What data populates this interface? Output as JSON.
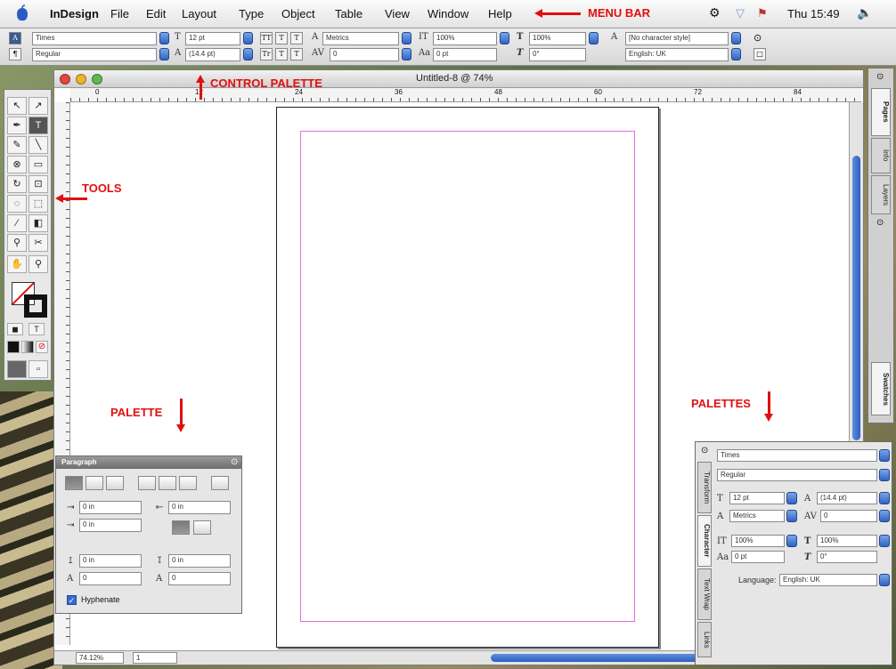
{
  "menubar": {
    "app": "InDesign",
    "items": [
      "File",
      "Edit",
      "Layout",
      "Type",
      "Object",
      "Table",
      "View",
      "Window",
      "Help"
    ],
    "clock": "Thu 15:49"
  },
  "annotations": {
    "menu_bar": "MENU BAR",
    "control_palette": "CONTROL PALETTE",
    "tools": "TOOLS",
    "palette": "PALETTE",
    "palettes": "PALETTES"
  },
  "control": {
    "font": "Times",
    "style": "Regular",
    "size": "12 pt",
    "leading": "(14.4 pt)",
    "kerning": "Metrics",
    "tracking": "0",
    "vscale": "100%",
    "hscale": "100%",
    "baseline": "0 pt",
    "skew": "0°",
    "char_style": "[No character style]",
    "language": "English: UK"
  },
  "document": {
    "title": "Untitled-8 @ 74%",
    "ruler_marks": [
      "0",
      "12",
      "24",
      "36",
      "48",
      "60",
      "72",
      "84"
    ]
  },
  "status": {
    "zoom": "74.12%",
    "page": "1"
  },
  "paragraph_palette": {
    "tab": "Paragraph",
    "left_indent": "0 in",
    "right_indent": "0 in",
    "first_indent": "0 in",
    "space_before": "0 in",
    "space_after": "0 in",
    "drop_lines": "0",
    "drop_chars": "0",
    "hyphenate_label": "Hyphenate"
  },
  "character_palette": {
    "tabs": [
      "Character",
      "Transform",
      "Text Wrap",
      "Links"
    ],
    "font": "Times",
    "style": "Regular",
    "size": "12 pt",
    "leading": "(14.4 pt)",
    "kerning": "Metrics",
    "tracking": "0",
    "vscale": "100%",
    "hscale": "100%",
    "baseline": "0 pt",
    "skew": "0°",
    "language_label": "Language:",
    "language": "English: UK"
  },
  "dock_tabs": [
    "Pages",
    "Info",
    "Layers",
    "Swatches"
  ]
}
